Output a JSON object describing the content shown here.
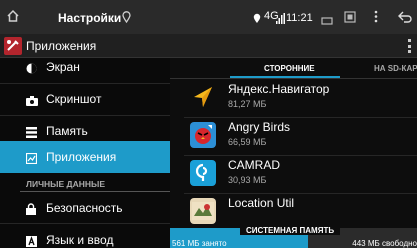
{
  "status_bar": {
    "title": "Настройки",
    "network": "4G",
    "time": "11:21",
    "icons": [
      "home-icon",
      "location-icon",
      "signal-icon",
      "screen-icon",
      "screenshot-icon",
      "more-icon",
      "back-icon"
    ]
  },
  "action_bar": {
    "title": "Приложения",
    "logo": "settings-logo-icon"
  },
  "sidebar": {
    "items": [
      {
        "label": "Экран",
        "icon": "brightness-icon"
      },
      {
        "label": "Скриншот",
        "icon": "camera-icon"
      },
      {
        "label": "Память",
        "icon": "storage-icon"
      },
      {
        "label": "Приложения",
        "icon": "apps-icon"
      },
      {
        "label": "Безопасность",
        "icon": "lock-icon"
      },
      {
        "label": "Язык и ввод",
        "icon": "language-icon"
      }
    ],
    "section_header": "ЛИЧНЫЕ ДАННЫЕ",
    "active_label": "Приложения"
  },
  "tabs": [
    {
      "label": "СТОРОННИЕ",
      "active": true
    },
    {
      "label": "НА SD-КАР",
      "active": false
    }
  ],
  "apps": [
    {
      "name": "Яндекс.Навигатор",
      "size": "81,27 МБ",
      "icon": "yandex-navigator-icon"
    },
    {
      "name": "Angry Birds",
      "size": "66,59 МБ",
      "icon": "angry-birds-icon"
    },
    {
      "name": "CAMRAD",
      "size": "30,93 МБ",
      "icon": "camrad-icon"
    },
    {
      "name": "Location Util",
      "size": "",
      "icon": "location-util-icon"
    }
  ],
  "storage": {
    "title": "СИСТЕМНАЯ ПАМЯТЬ",
    "used": "561 МБ занято",
    "free": "443 МБ свободно",
    "used_fraction": 0.56
  },
  "colors": {
    "accent": "#1e9bc9",
    "status_bar_bg": "#2a2a2a",
    "background": "#0d0d0d"
  }
}
